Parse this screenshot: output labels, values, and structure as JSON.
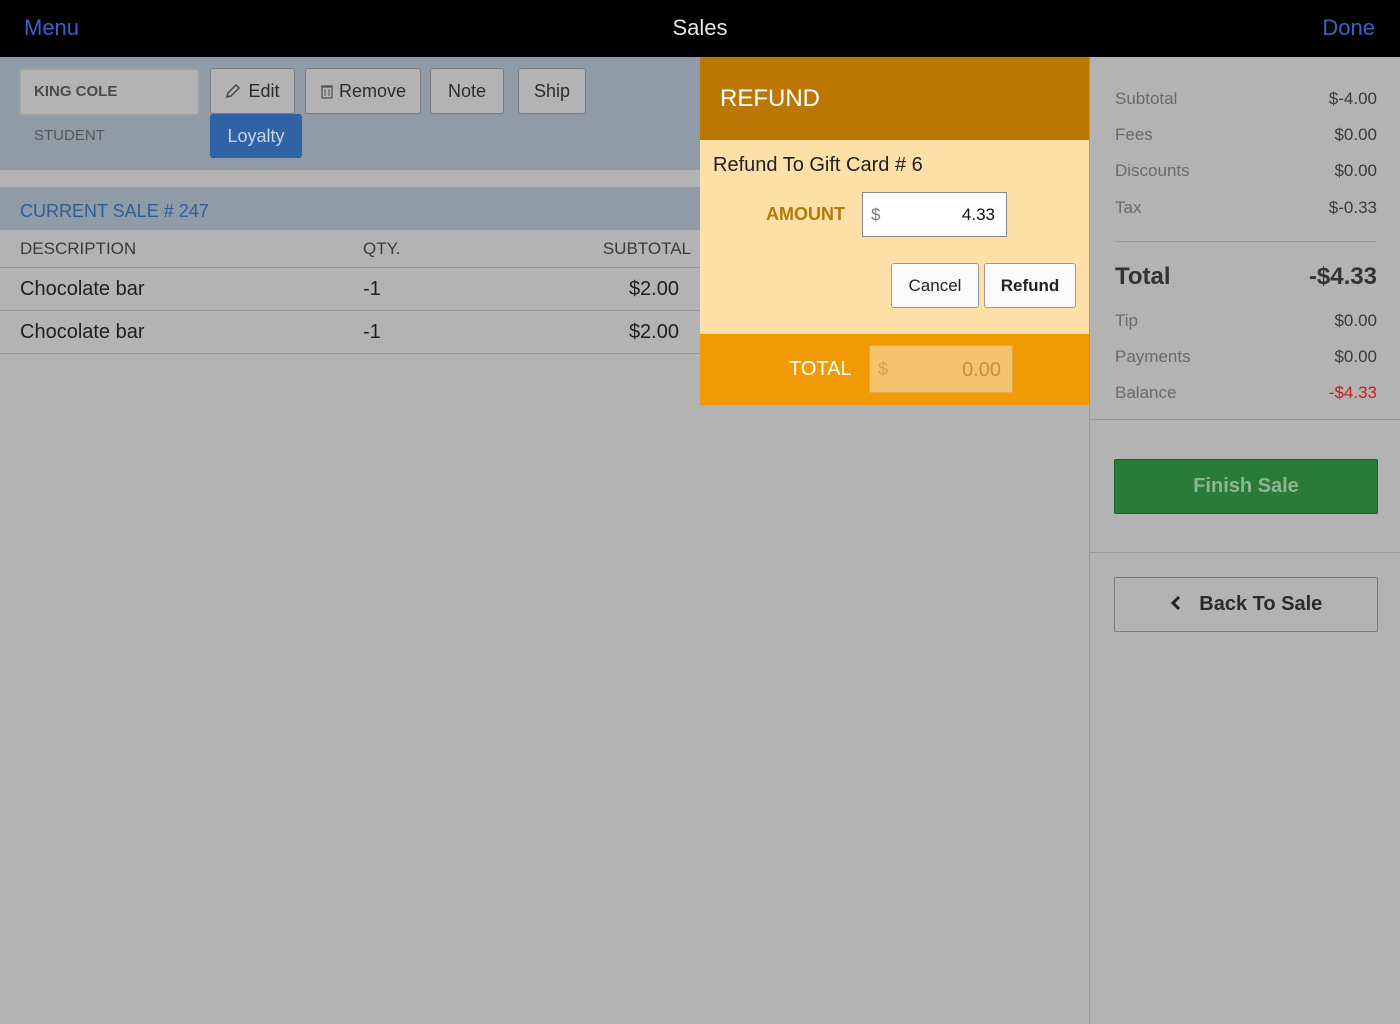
{
  "topbar": {
    "menu": "Menu",
    "title": "Sales",
    "done": "Done"
  },
  "toolbar": {
    "customer_name": "KING COLE",
    "customer_type": "STUDENT",
    "edit": "Edit",
    "remove": "Remove",
    "note": "Note",
    "ship": "Ship",
    "loyalty": "Loyalty"
  },
  "sale": {
    "header": "CURRENT SALE # 247",
    "columns": {
      "description": "DESCRIPTION",
      "qty": "QTY.",
      "subtotal": "SUBTOTAL"
    },
    "items": [
      {
        "description": "Chocolate bar",
        "qty": "-1",
        "subtotal": "$2.00"
      },
      {
        "description": "Chocolate bar",
        "qty": "-1",
        "subtotal": "$2.00"
      }
    ]
  },
  "summary": {
    "subtotal": {
      "label": "Subtotal",
      "value": "$-4.00"
    },
    "fees": {
      "label": "Fees",
      "value": "$0.00"
    },
    "discounts": {
      "label": "Discounts",
      "value": "$0.00"
    },
    "tax": {
      "label": "Tax",
      "value": "$-0.33"
    },
    "total": {
      "label": "Total",
      "value": "-$4.33"
    },
    "tip": {
      "label": "Tip",
      "value": "$0.00"
    },
    "payments": {
      "label": "Payments",
      "value": "$0.00"
    },
    "balance": {
      "label": "Balance",
      "value": "-$4.33"
    },
    "finish_sale": "Finish Sale",
    "back_to_sale": "Back To Sale"
  },
  "modal": {
    "title": "REFUND",
    "refund_to": "Refund To Gift Card # 6",
    "amount_label": "AMOUNT",
    "amount_currency": "$",
    "amount_value": "4.33",
    "cancel": "Cancel",
    "refund": "Refund",
    "total_label": "TOTAL",
    "total_currency": "$",
    "total_value": "0.00"
  },
  "colors": {
    "accent_blue": "#3a62c9",
    "modal_header": "#bb7702",
    "modal_footer": "#f09b04",
    "finish_green": "#2a7a3a",
    "balance_red": "#c81e1e"
  }
}
